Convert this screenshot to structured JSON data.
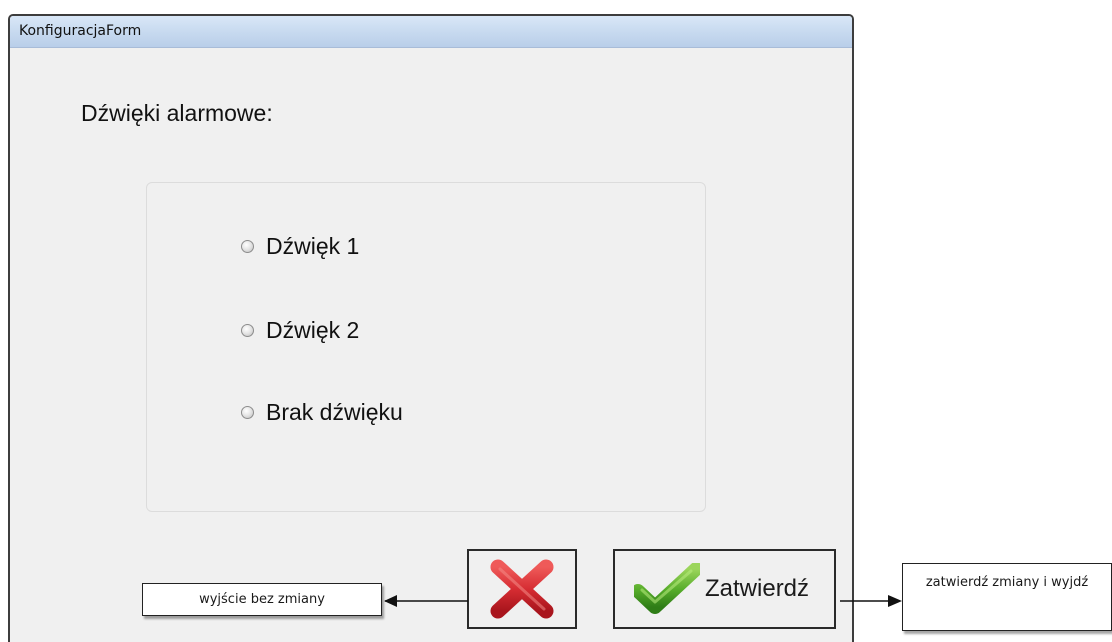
{
  "window": {
    "title": "KonfiguracjaForm"
  },
  "main": {
    "heading": "Dźwięki alarmowe:",
    "sound_options": [
      {
        "label": "Dźwięk 1",
        "selected": false
      },
      {
        "label": "Dźwięk 2",
        "selected": false
      },
      {
        "label": "Brak dźwięku",
        "selected": false
      }
    ]
  },
  "actions": {
    "cancel_icon": "close-icon",
    "confirm_icon": "checkmark-icon",
    "confirm_label": "Zatwierdź"
  },
  "annotations": {
    "cancel_note": "wyjście bez zmiany",
    "confirm_note": "zatwierdź zmiany i wyjdź"
  },
  "colors": {
    "window_background": "#f0f0f0",
    "titlebar_background": "#c6d9ef",
    "cancel_icon": "#c7252e",
    "confirm_icon": "#65b52f"
  }
}
